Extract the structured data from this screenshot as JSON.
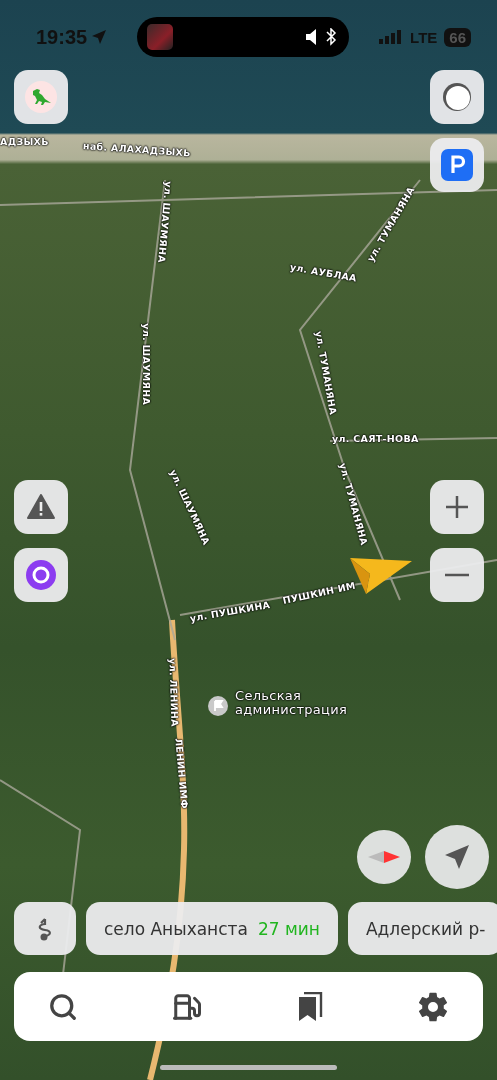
{
  "status_bar": {
    "time": "19:35",
    "network": "LTE",
    "battery": "66"
  },
  "map_labels": [
    {
      "kind": "street",
      "text": "АДЗЫХЬ"
    },
    {
      "kind": "street",
      "text": "наб. АЛАХАДЗЫХЬ"
    },
    {
      "kind": "street",
      "text": "ул. ШАУМЯНА"
    },
    {
      "kind": "street",
      "text": "ул. ТУМАНЯНА"
    },
    {
      "kind": "street",
      "text": "ул. АУБЛАА"
    },
    {
      "kind": "street",
      "text": "ул. ШАУМЯНА"
    },
    {
      "kind": "street",
      "text": "ул. ТУМАНЯНА"
    },
    {
      "kind": "street",
      "text": "ул. САЯТ-НОВА"
    },
    {
      "kind": "street",
      "text": "ул. ТУМАНЯНА"
    },
    {
      "kind": "street",
      "text": "ул. ШАУМЯНА"
    },
    {
      "kind": "street",
      "text": "ул. ПУШКИНА"
    },
    {
      "kind": "street",
      "text": "ПУШКИН ИМ"
    },
    {
      "kind": "street",
      "text": "ул. ЛЕНИНА"
    },
    {
      "kind": "street",
      "text": "ЛЕНИН ИМФ"
    },
    {
      "kind": "poi",
      "text": "Сельская администрация"
    }
  ],
  "route_chips": [
    {
      "destination": "село Аныханста",
      "eta": "27 мин"
    },
    {
      "destination": "Адлерский р-"
    }
  ]
}
